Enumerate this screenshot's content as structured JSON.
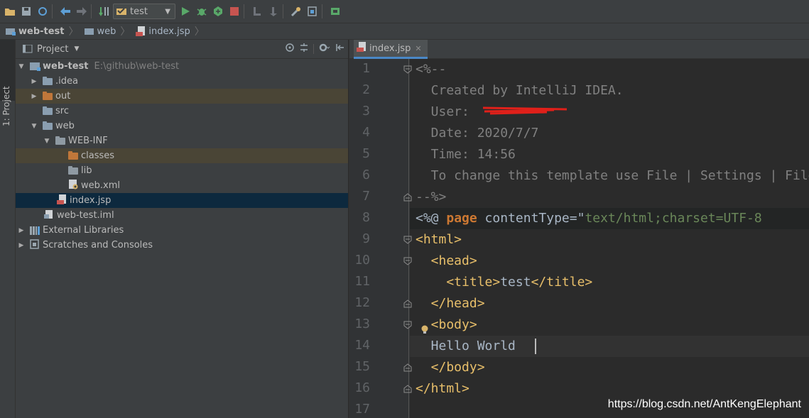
{
  "toolbar": {
    "run_config": "test",
    "icons": [
      "open-icon",
      "save-icon",
      "sync-icon",
      "back-icon",
      "forward-icon",
      "build-icon",
      "run-config-icon",
      "run-icon",
      "debug-icon",
      "coverage-icon",
      "stop-icon",
      "attach-icon",
      "profile-icon",
      "settings-icon",
      "structure-icon",
      "sdk-icon"
    ]
  },
  "breadcrumbs": [
    {
      "label": "web-test"
    },
    {
      "label": "web"
    },
    {
      "label": "index.jsp"
    }
  ],
  "side_tab": {
    "label": "1: Project"
  },
  "project_panel": {
    "title": "Project",
    "tree": [
      {
        "label": "web-test",
        "path": "E:\\github\\web-test",
        "kind": "module",
        "level": 0,
        "expanded": true
      },
      {
        "label": ".idea",
        "kind": "folder",
        "level": 1,
        "expanded": false
      },
      {
        "label": "out",
        "kind": "folder-excluded",
        "level": 1,
        "expanded": false
      },
      {
        "label": "src",
        "kind": "folder",
        "level": 1
      },
      {
        "label": "web",
        "kind": "folder",
        "level": 1,
        "expanded": true
      },
      {
        "label": "WEB-INF",
        "kind": "folder",
        "level": 2,
        "expanded": true
      },
      {
        "label": "classes",
        "kind": "folder-excluded",
        "level": 3
      },
      {
        "label": "lib",
        "kind": "folder",
        "level": 3
      },
      {
        "label": "web.xml",
        "kind": "xml",
        "level": 3
      },
      {
        "label": "index.jsp",
        "kind": "jsp",
        "level": 2,
        "selected": true
      },
      {
        "label": "web-test.iml",
        "kind": "iml",
        "level": 1
      },
      {
        "label": "External Libraries",
        "kind": "library",
        "level": 0,
        "expanded": false
      },
      {
        "label": "Scratches and Consoles",
        "kind": "scratch",
        "level": 0,
        "expanded": false
      }
    ]
  },
  "editor": {
    "tab_label": "index.jsp",
    "line_numbers": [
      "1",
      "2",
      "3",
      "4",
      "5",
      "6",
      "7",
      "8",
      "9",
      "10",
      "11",
      "12",
      "13",
      "14",
      "15",
      "16",
      "17"
    ],
    "lines": {
      "l1": "<%--",
      "l2": "  Created by IntelliJ IDEA.",
      "l3": "  User: ",
      "l4": "  Date: 2020/7/7",
      "l5": "  Time: 14:56",
      "l6": "  To change this template use File | Settings | File Templates.",
      "l7": "--%>",
      "l8a": "<%@ ",
      "l8b": "page",
      "l8c": " contentType=",
      "l8d": "\"",
      "l8e": "text/html;charset=UTF-8",
      "l9": "<html>",
      "l10": "  <head>",
      "l11a": "    <title>",
      "l11b": "test",
      "l11c": "</title>",
      "l12": "  </head>",
      "l13": "  <body>",
      "l14": "  Hello World",
      "l15": "  </body>",
      "l16": "</html>"
    }
  },
  "watermark": "https://blog.csdn.net/AntKengElephant"
}
